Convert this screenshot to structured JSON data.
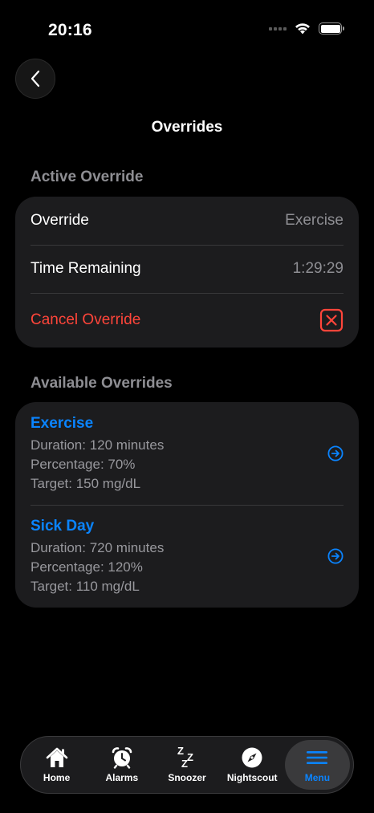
{
  "status_bar": {
    "time": "20:16"
  },
  "header": {
    "title": "Overrides"
  },
  "active_section": {
    "header": "Active Override",
    "override_label": "Override",
    "override_value": "Exercise",
    "time_label": "Time Remaining",
    "time_value": "1:29:29",
    "cancel_label": "Cancel Override"
  },
  "available_section": {
    "header": "Available Overrides",
    "items": [
      {
        "name": "Exercise",
        "duration": "Duration: 120 minutes",
        "percentage": "Percentage: 70%",
        "target": "Target: 150 mg/dL"
      },
      {
        "name": "Sick Day",
        "duration": "Duration: 720 minutes",
        "percentage": "Percentage: 120%",
        "target": "Target: 110 mg/dL"
      }
    ]
  },
  "tabs": [
    {
      "label": "Home",
      "icon": "house-icon"
    },
    {
      "label": "Alarms",
      "icon": "alarm-clock-icon"
    },
    {
      "label": "Snoozer",
      "icon": "zzz-icon"
    },
    {
      "label": "Nightscout",
      "icon": "compass-icon"
    },
    {
      "label": "Menu",
      "icon": "menu-icon",
      "selected": true
    }
  ],
  "colors": {
    "accent": "#0a84ff",
    "destructive": "#ff453a",
    "card": "#1c1c1e",
    "background": "#000000"
  }
}
